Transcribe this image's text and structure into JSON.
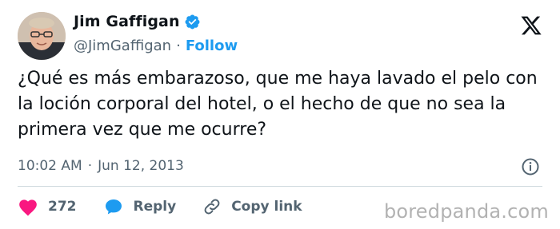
{
  "author": {
    "name": "Jim Gaffigan",
    "handle": "@JimGaffigan",
    "follow_label": "Follow",
    "separator": "·",
    "verified_color": "#1d9bf0",
    "avatar_icon": "avatar-photo"
  },
  "tweet": {
    "text": "¿Qué es más embarazoso, que me haya lavado el pelo con la loción corporal del hotel, o el hecho de que no sea la primera vez que me ocurre?"
  },
  "meta": {
    "time": "10:02 AM",
    "separator": "·",
    "date": "Jun 12, 2013",
    "info_icon": "info-icon"
  },
  "actions": {
    "like_count": "272",
    "reply_label": "Reply",
    "copy_link_label": "Copy link",
    "like_color": "#f91880",
    "reply_color": "#1d9bf0"
  },
  "brand": {
    "logo_icon": "x-logo-icon"
  },
  "watermark": "boredpanda.com"
}
